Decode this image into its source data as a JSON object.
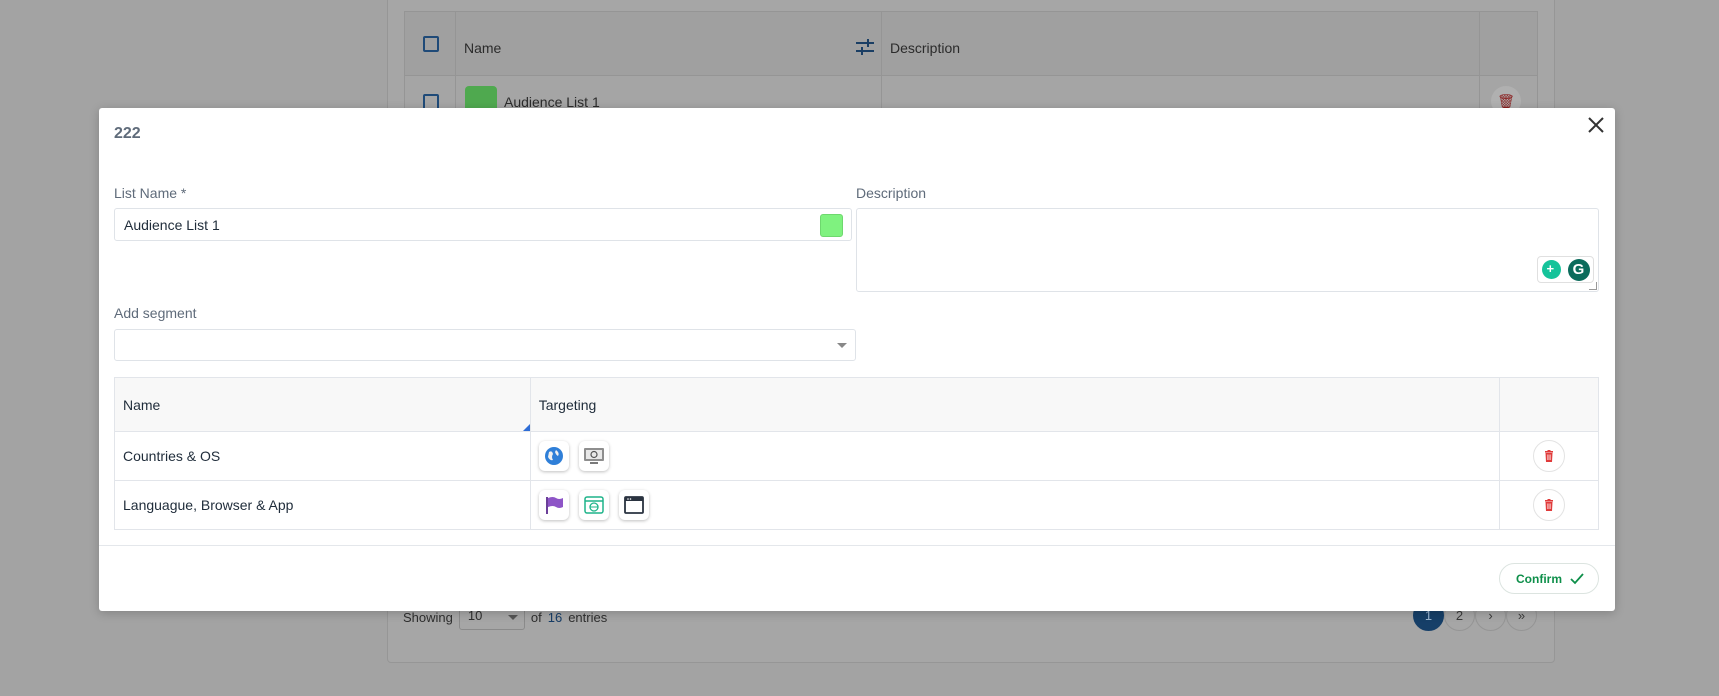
{
  "background": {
    "table": {
      "headers": {
        "name": "Name",
        "description": "Description"
      },
      "rows": [
        {
          "name": "Audience List 1",
          "color": "#4fa94f"
        }
      ]
    },
    "footer": {
      "showing": "Showing",
      "page_size": "10",
      "of": "of",
      "total": "16",
      "entries": "entries"
    },
    "pagination": {
      "pages": [
        "1",
        "2"
      ],
      "next": "›",
      "last": "»"
    }
  },
  "modal": {
    "title": "222",
    "list_name_label": "List Name *",
    "list_name_value": "Audience List 1",
    "list_color": "#7ff27f",
    "description_label": "Description",
    "description_value": "",
    "add_segment_label": "Add segment",
    "add_segment_value": "",
    "table": {
      "headers": {
        "name": "Name",
        "targeting": "Targeting"
      },
      "rows": [
        {
          "name": "Countries & OS",
          "targeting_icons": [
            "globe-icon",
            "monitor-icon"
          ]
        },
        {
          "name": "Languague, Browser & App",
          "targeting_icons": [
            "flag-icon",
            "browser-globe-icon",
            "app-window-icon"
          ]
        }
      ]
    },
    "confirm_label": "Confirm",
    "accent": "#0e8f4a"
  }
}
